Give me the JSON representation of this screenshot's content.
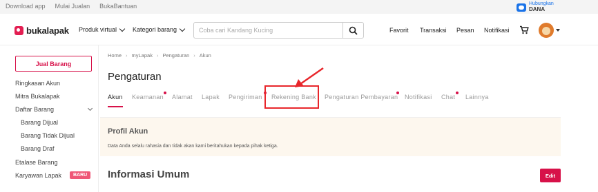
{
  "topbar": {
    "links": [
      "Download app",
      "Mulai Jualan",
      "BukaBantuan"
    ],
    "dana_line1": "Hubungkan",
    "dana_line2": "DANA"
  },
  "header": {
    "logo_text": "bukalapak",
    "produk_virtual": "Produk virtual",
    "kategori_barang": "Kategori barang",
    "search_placeholder": "Coba cari Kandang Kucing",
    "favorit": "Favorit",
    "transaksi": "Transaksi",
    "pesan": "Pesan",
    "notifikasi": "Notifikasi"
  },
  "sidebar": {
    "jual_barang": "Jual Barang",
    "items": [
      "Ringkasan Akun",
      "Mitra Bukalapak",
      "Daftar Barang",
      "Barang Dijual",
      "Barang Tidak Dijual",
      "Barang Draf",
      "Etalase Barang",
      "Karyawan Lapak"
    ],
    "badge_baru": "BARU"
  },
  "breadcrumb": [
    "Home",
    "myLapak",
    "Pengaturan",
    "Akun"
  ],
  "page_title": "Pengaturan",
  "tabs": [
    "Akun",
    "Keamanan",
    "Alamat",
    "Lapak",
    "Pengiriman",
    "Rekening Bank",
    "Pengaturan Pembayaran",
    "Notifikasi",
    "Chat",
    "Lainnya"
  ],
  "profile": {
    "title": "Profil Akun",
    "desc": "Data Anda selalu rahasia dan tidak akan kami beritahukan kepada pihak ketiga."
  },
  "info_umum": {
    "title": "Informasi Umum",
    "edit": "Edit"
  },
  "colors": {
    "brand": "#d71149",
    "highlight": "#e8262b"
  }
}
